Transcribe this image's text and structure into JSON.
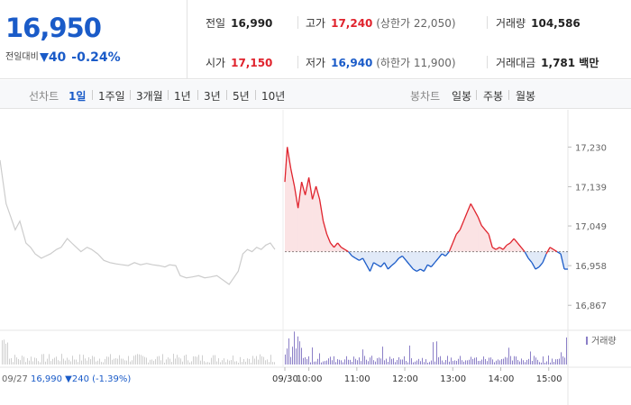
{
  "header": {
    "current_price": "16,950",
    "change_label": "전일대비",
    "change_amount": "40",
    "change_pct": "-0.24%",
    "stats": {
      "prev": {
        "label": "전일",
        "value": "16,990"
      },
      "high": {
        "label": "고가",
        "value": "17,240",
        "note": "(상한가 22,050)"
      },
      "volume": {
        "label": "거래량",
        "value": "104,586"
      },
      "open": {
        "label": "시가",
        "value": "17,150"
      },
      "low": {
        "label": "저가",
        "value": "16,940",
        "note": "(하한가 11,900)"
      },
      "amount": {
        "label": "거래대금",
        "value": "1,781 백만"
      }
    }
  },
  "toolbar": {
    "line_label": "선차트",
    "periods": [
      "1일",
      "1주일",
      "3개월",
      "1년",
      "3년",
      "5년",
      "10년"
    ],
    "active_period": "1일",
    "candle_label": "봉차트",
    "candles": [
      "일봉",
      "주봉",
      "월봉"
    ]
  },
  "colors": {
    "up": "#e0232d",
    "down": "#1a5bc8",
    "prev_day": "#cccccc",
    "volume": "#8b7fc7"
  },
  "chart_data": {
    "type": "line",
    "ylim": [
      16820,
      17270
    ],
    "yticks": [
      "17,230",
      "17,139",
      "17,049",
      "16,958",
      "16,867"
    ],
    "ytick_values": [
      17230,
      17139,
      17049,
      16958,
      16867
    ],
    "baseline": 16990,
    "xticks": [
      "09/30",
      "10:00",
      "11:00",
      "12:00",
      "13:00",
      "14:00",
      "15:00"
    ],
    "volume_label": "거래량",
    "prev_day_label": "09/27",
    "prev_day_summary": "16,990 ▼240 (-1.39%)",
    "prev_day_series": [
      {
        "t": 0,
        "v": 17200
      },
      {
        "t": 0.4,
        "v": 17100
      },
      {
        "t": 0.7,
        "v": 17070
      },
      {
        "t": 1.0,
        "v": 17040
      },
      {
        "t": 1.3,
        "v": 17060
      },
      {
        "t": 1.7,
        "v": 17010
      },
      {
        "t": 2.0,
        "v": 17000
      },
      {
        "t": 2.3,
        "v": 16985
      },
      {
        "t": 2.7,
        "v": 16975
      },
      {
        "t": 3.0,
        "v": 16980
      },
      {
        "t": 3.3,
        "v": 16985
      },
      {
        "t": 3.7,
        "v": 16995
      },
      {
        "t": 4.0,
        "v": 17000
      },
      {
        "t": 4.4,
        "v": 17020
      },
      {
        "t": 4.7,
        "v": 17010
      },
      {
        "t": 5.0,
        "v": 17000
      },
      {
        "t": 5.3,
        "v": 16990
      },
      {
        "t": 5.7,
        "v": 17000
      },
      {
        "t": 6.0,
        "v": 16995
      },
      {
        "t": 6.4,
        "v": 16985
      },
      {
        "t": 6.8,
        "v": 16970
      },
      {
        "t": 7.2,
        "v": 16965
      },
      {
        "t": 7.6,
        "v": 16962
      },
      {
        "t": 8.0,
        "v": 16960
      },
      {
        "t": 8.4,
        "v": 16958
      },
      {
        "t": 8.8,
        "v": 16965
      },
      {
        "t": 9.2,
        "v": 16960
      },
      {
        "t": 9.6,
        "v": 16963
      },
      {
        "t": 10.0,
        "v": 16960
      },
      {
        "t": 10.4,
        "v": 16958
      },
      {
        "t": 10.8,
        "v": 16955
      },
      {
        "t": 11.1,
        "v": 16960
      },
      {
        "t": 11.5,
        "v": 16958
      },
      {
        "t": 11.8,
        "v": 16935
      },
      {
        "t": 12.2,
        "v": 16930
      },
      {
        "t": 12.6,
        "v": 16932
      },
      {
        "t": 13.0,
        "v": 16935
      },
      {
        "t": 13.4,
        "v": 16930
      },
      {
        "t": 13.8,
        "v": 16932
      },
      {
        "t": 14.2,
        "v": 16935
      },
      {
        "t": 14.6,
        "v": 16925
      },
      {
        "t": 15.0,
        "v": 16915
      },
      {
        "t": 15.3,
        "v": 16930
      },
      {
        "t": 15.6,
        "v": 16945
      },
      {
        "t": 15.9,
        "v": 16985
      },
      {
        "t": 16.2,
        "v": 16995
      },
      {
        "t": 16.5,
        "v": 16990
      },
      {
        "t": 16.8,
        "v": 17000
      },
      {
        "t": 17.1,
        "v": 16995
      },
      {
        "t": 17.4,
        "v": 17005
      },
      {
        "t": 17.7,
        "v": 17010
      },
      {
        "t": 18.0,
        "v": 16995
      }
    ],
    "today_series": [
      {
        "t": 0,
        "v": 17150
      },
      {
        "t": 0.1,
        "v": 17230
      },
      {
        "t": 0.25,
        "v": 17180
      },
      {
        "t": 0.4,
        "v": 17140
      },
      {
        "t": 0.55,
        "v": 17090
      },
      {
        "t": 0.7,
        "v": 17150
      },
      {
        "t": 0.85,
        "v": 17120
      },
      {
        "t": 1.0,
        "v": 17160
      },
      {
        "t": 1.15,
        "v": 17110
      },
      {
        "t": 1.3,
        "v": 17140
      },
      {
        "t": 1.45,
        "v": 17110
      },
      {
        "t": 1.6,
        "v": 17060
      },
      {
        "t": 1.75,
        "v": 17030
      },
      {
        "t": 1.9,
        "v": 17010
      },
      {
        "t": 2.05,
        "v": 17000
      },
      {
        "t": 2.2,
        "v": 17010
      },
      {
        "t": 2.35,
        "v": 17000
      },
      {
        "t": 2.5,
        "v": 16995
      },
      {
        "t": 2.65,
        "v": 16990
      },
      {
        "t": 2.8,
        "v": 16980
      },
      {
        "t": 2.95,
        "v": 16975
      },
      {
        "t": 3.1,
        "v": 16970
      },
      {
        "t": 3.25,
        "v": 16975
      },
      {
        "t": 3.4,
        "v": 16960
      },
      {
        "t": 3.55,
        "v": 16945
      },
      {
        "t": 3.7,
        "v": 16965
      },
      {
        "t": 3.85,
        "v": 16960
      },
      {
        "t": 4.0,
        "v": 16955
      },
      {
        "t": 4.15,
        "v": 16965
      },
      {
        "t": 4.3,
        "v": 16950
      },
      {
        "t": 4.45,
        "v": 16958
      },
      {
        "t": 4.6,
        "v": 16965
      },
      {
        "t": 4.75,
        "v": 16975
      },
      {
        "t": 4.9,
        "v": 16980
      },
      {
        "t": 5.05,
        "v": 16970
      },
      {
        "t": 5.2,
        "v": 16960
      },
      {
        "t": 5.35,
        "v": 16950
      },
      {
        "t": 5.5,
        "v": 16945
      },
      {
        "t": 5.65,
        "v": 16950
      },
      {
        "t": 5.8,
        "v": 16945
      },
      {
        "t": 5.95,
        "v": 16960
      },
      {
        "t": 6.1,
        "v": 16955
      },
      {
        "t": 6.25,
        "v": 16965
      },
      {
        "t": 6.4,
        "v": 16975
      },
      {
        "t": 6.55,
        "v": 16985
      },
      {
        "t": 6.7,
        "v": 16980
      },
      {
        "t": 6.85,
        "v": 16990
      },
      {
        "t": 7.0,
        "v": 17010
      },
      {
        "t": 7.15,
        "v": 17030
      },
      {
        "t": 7.3,
        "v": 17040
      },
      {
        "t": 7.45,
        "v": 17060
      },
      {
        "t": 7.6,
        "v": 17080
      },
      {
        "t": 7.75,
        "v": 17100
      },
      {
        "t": 7.9,
        "v": 17085
      },
      {
        "t": 8.05,
        "v": 17070
      },
      {
        "t": 8.2,
        "v": 17050
      },
      {
        "t": 8.35,
        "v": 17040
      },
      {
        "t": 8.5,
        "v": 17030
      },
      {
        "t": 8.65,
        "v": 17000
      },
      {
        "t": 8.8,
        "v": 16995
      },
      {
        "t": 8.95,
        "v": 17000
      },
      {
        "t": 9.1,
        "v": 16995
      },
      {
        "t": 9.25,
        "v": 17005
      },
      {
        "t": 9.4,
        "v": 17010
      },
      {
        "t": 9.55,
        "v": 17020
      },
      {
        "t": 9.7,
        "v": 17010
      },
      {
        "t": 9.85,
        "v": 17000
      },
      {
        "t": 10.0,
        "v": 16990
      },
      {
        "t": 10.15,
        "v": 16975
      },
      {
        "t": 10.3,
        "v": 16965
      },
      {
        "t": 10.45,
        "v": 16950
      },
      {
        "t": 10.6,
        "v": 16955
      },
      {
        "t": 10.75,
        "v": 16965
      },
      {
        "t": 10.9,
        "v": 16985
      },
      {
        "t": 11.05,
        "v": 17000
      },
      {
        "t": 11.2,
        "v": 16995
      },
      {
        "t": 11.35,
        "v": 16990
      },
      {
        "t": 11.5,
        "v": 16985
      },
      {
        "t": 11.65,
        "v": 16950
      },
      {
        "t": 11.8,
        "v": 16950
      }
    ],
    "today_t_range": [
      0,
      11.8
    ],
    "prev_t_range": [
      0,
      18.0
    ],
    "xtick_t": [
      0,
      1.0,
      3.0,
      5.0,
      7.0,
      9.0,
      11.0
    ]
  }
}
